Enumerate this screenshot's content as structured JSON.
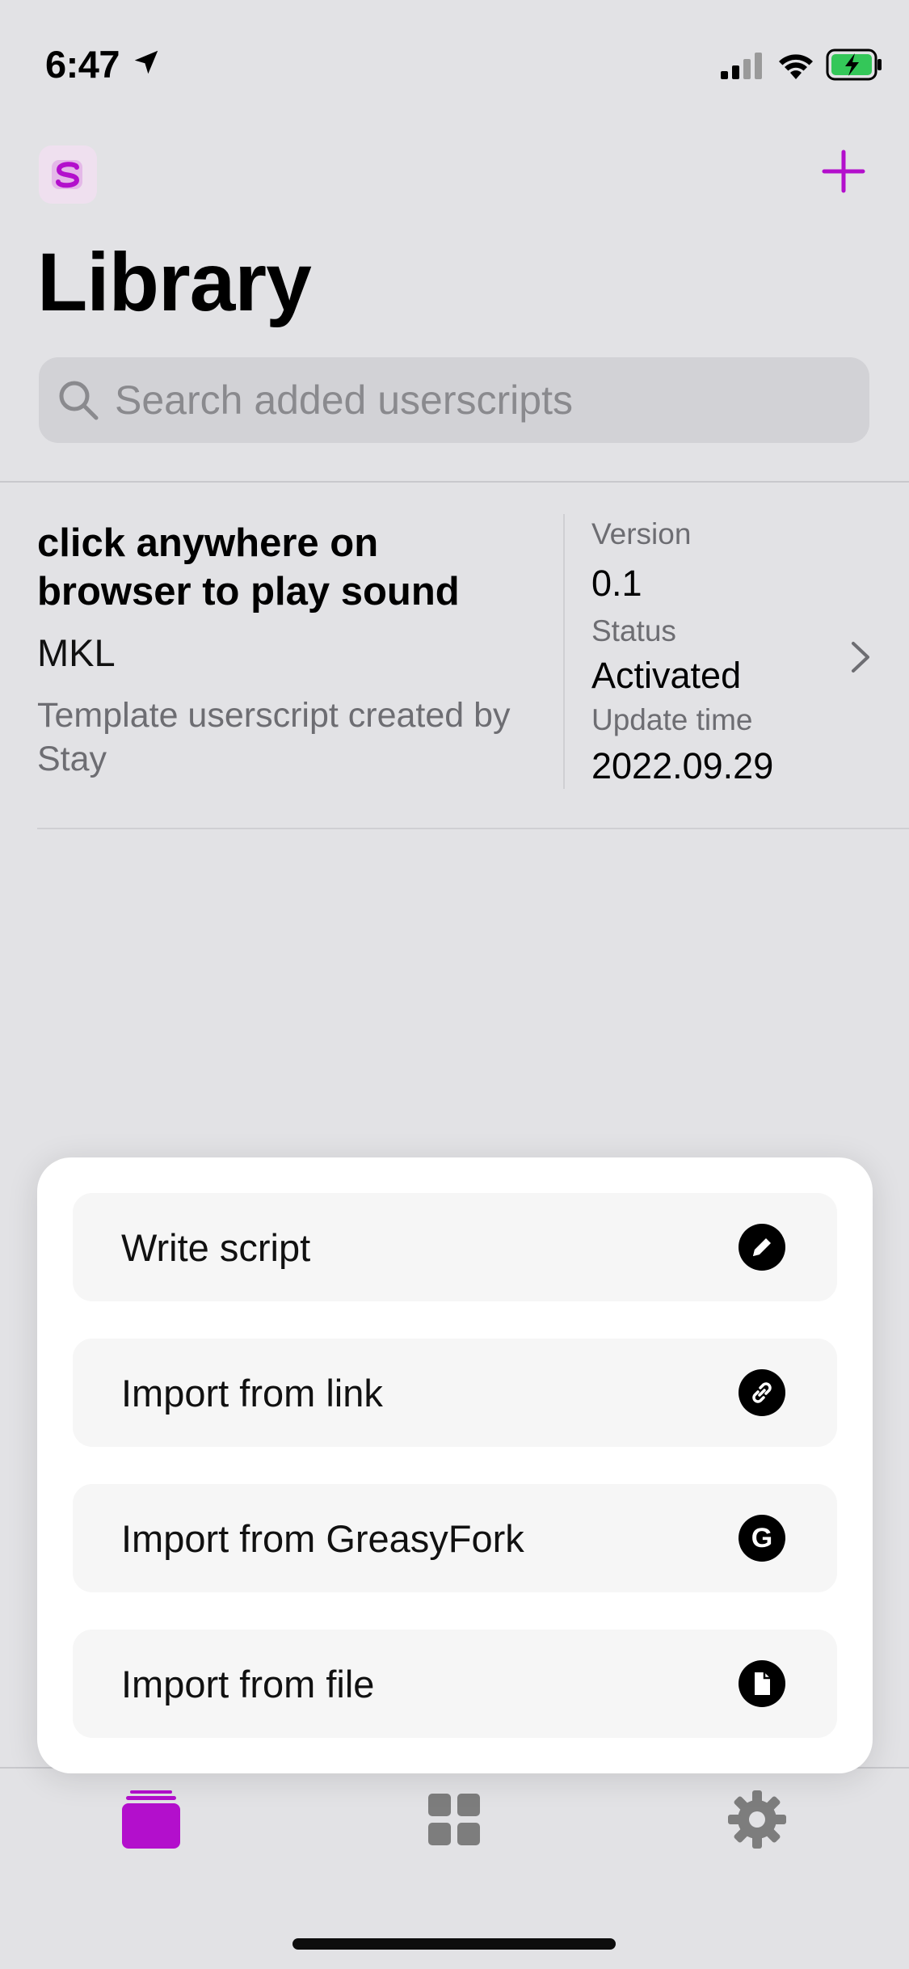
{
  "status_bar": {
    "time": "6:47"
  },
  "header": {
    "title": "Library"
  },
  "search": {
    "placeholder": "Search added userscripts"
  },
  "scripts": [
    {
      "name": "click anywhere on browser to play sound",
      "author": "MKL",
      "description": "Template userscript created by Stay",
      "version_label": "Version",
      "version": "0.1",
      "status_label": "Status",
      "status": "Activated",
      "update_label": "Update time",
      "update_time": "2022.09.29"
    }
  ],
  "menu": {
    "items": [
      {
        "label": "Write script",
        "icon": "pencil-icon"
      },
      {
        "label": "Import from link",
        "icon": "link-icon"
      },
      {
        "label": "Import from GreasyFork",
        "icon": "greasyfork-icon",
        "icon_glyph": "G"
      },
      {
        "label": "Import from file",
        "icon": "file-icon"
      }
    ]
  },
  "tabs": [
    {
      "name": "library",
      "icon": "library-stack-icon",
      "active": true
    },
    {
      "name": "explore",
      "icon": "grid-icon",
      "active": false
    },
    {
      "name": "settings",
      "icon": "gear-icon",
      "active": false
    }
  ],
  "colors": {
    "accent": "#b30fcc",
    "background": "#e2e2e5",
    "inactive_icon": "#7d7d7d"
  }
}
